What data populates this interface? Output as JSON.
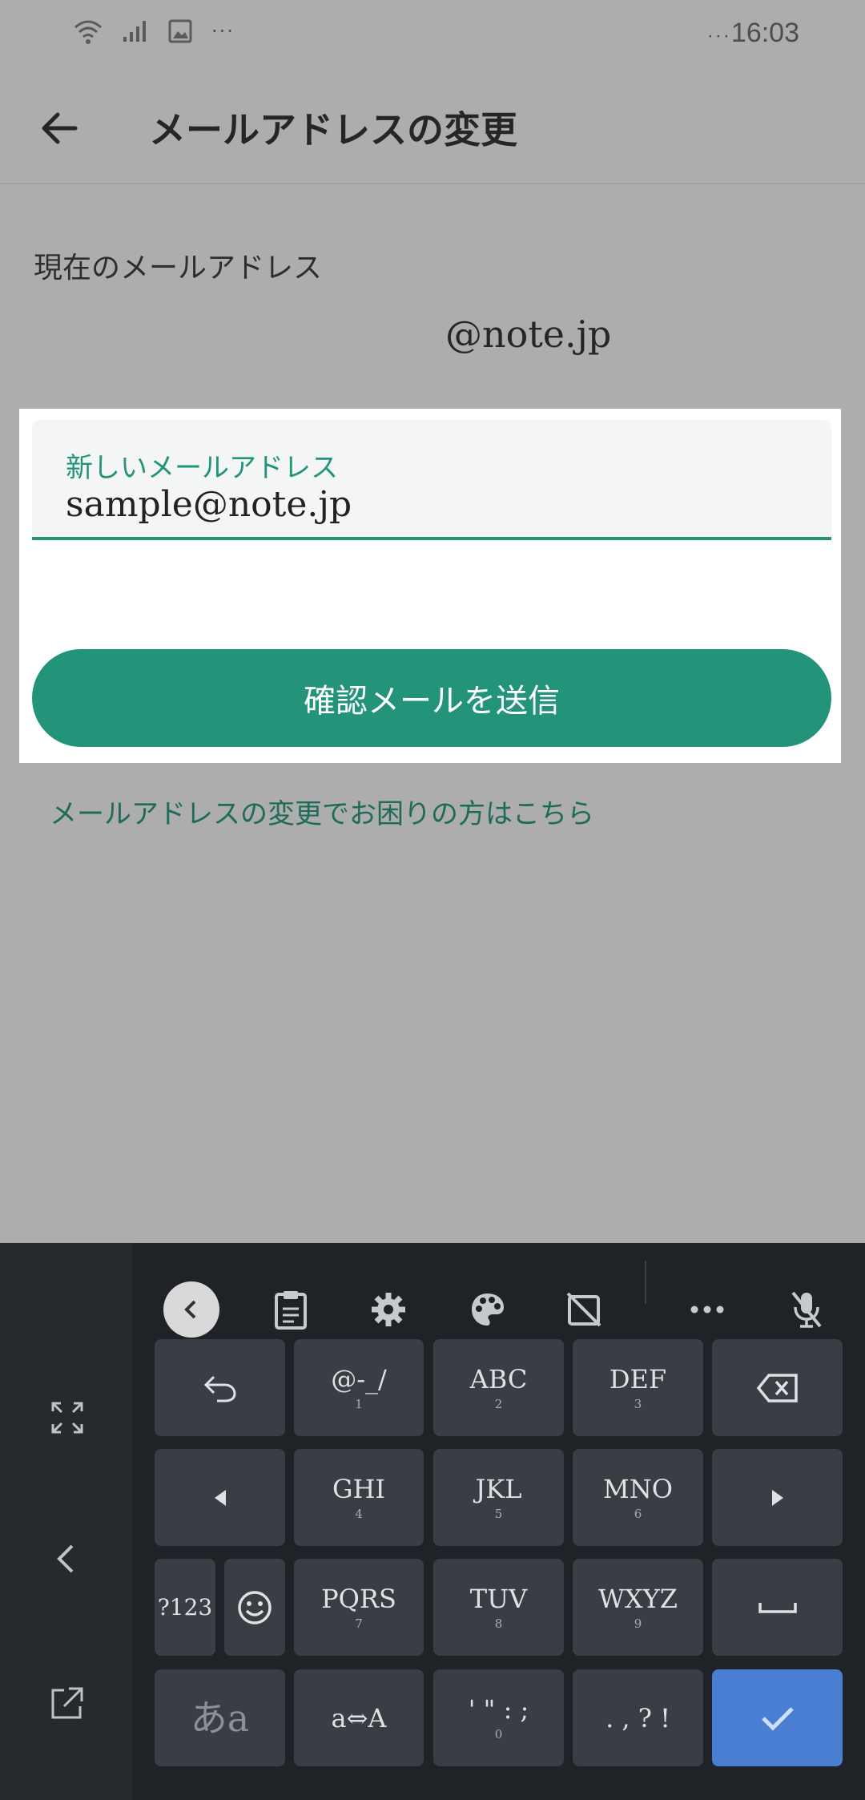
{
  "status_bar": {
    "time": "16:03",
    "overflow": "···",
    "time_prefix": "···"
  },
  "app_bar": {
    "title": "メールアドレスの変更"
  },
  "current": {
    "label": "現在のメールアドレス",
    "email": "@note.jp"
  },
  "form": {
    "field_label": "新しいメールアドレス",
    "field_value": "sample@note.jp",
    "submit_label": "確認メールを送信"
  },
  "help_link": "メールアドレスの変更でお困りの方はこちら",
  "keyboard": {
    "toolbar_icons": [
      "chevron-left-icon",
      "clipboard-icon",
      "gear-icon",
      "palette-icon",
      "no-image-icon",
      "more-icon",
      "mic-off-icon"
    ],
    "side_icons": [
      "fullscreen-icon",
      "chevron-left-icon",
      "popout-icon"
    ],
    "keys": {
      "k1": {
        "main": "@-_/",
        "sub": "1"
      },
      "k2": {
        "main": "ABC",
        "sub": "2"
      },
      "k3": {
        "main": "DEF",
        "sub": "3"
      },
      "k4": {
        "main": "GHI",
        "sub": "4"
      },
      "k5": {
        "main": "JKL",
        "sub": "5"
      },
      "k6": {
        "main": "MNO",
        "sub": "6"
      },
      "k7": {
        "main": "PQRS",
        "sub": "7"
      },
      "k8": {
        "main": "TUV",
        "sub": "8"
      },
      "k9": {
        "main": "WXYZ",
        "sub": "9"
      },
      "k0": {
        "main": "' \" : ;",
        "sub": "0"
      },
      "sym": "?123",
      "kana": "あa",
      "case": "a⇔A",
      "punct": ". , ? !"
    },
    "accent_color": "#4a7ed2"
  },
  "colors": {
    "brand": "#23937a"
  }
}
